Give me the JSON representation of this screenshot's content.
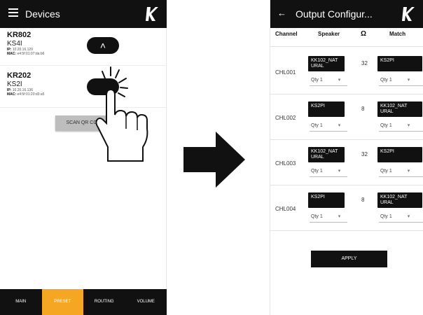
{
  "left_screen": {
    "title": "Devices",
    "devices": [
      {
        "name": "KR802",
        "model": "KS4I",
        "ip_label": "IP:",
        "ip": "10.20.16.120",
        "mac_label": "MAC:",
        "mac": "e4:5f:01:07:da:b6"
      },
      {
        "name": "KR202",
        "model": "KS2I",
        "ip_label": "IP:",
        "ip": "10.20.16.136",
        "mac_label": "MAC:",
        "mac": "e4:5f:01:20:d3:a5"
      }
    ],
    "collapse_glyph": "˄",
    "scan_button": "SCAN QR CODE",
    "bottom_nav": [
      "MAIN",
      "PRESET",
      "ROUTING",
      "VOLUME"
    ],
    "active_tab": "PRESET",
    "accent_color": "#f5a623"
  },
  "right_screen": {
    "title": "Output Configur...",
    "headers": {
      "channel": "Channel",
      "speaker": "Speaker",
      "ohm": "Ω",
      "match": "Match"
    },
    "rows": [
      {
        "channel": "CHL001",
        "speaker": "KK102_NAT URAL",
        "ohm": "32",
        "match": "KS2PI",
        "qty_speaker": "Qty 1",
        "qty_match": "Qty 1"
      },
      {
        "channel": "CHL002",
        "speaker": "KS2PI",
        "ohm": "8",
        "match": "KK102_NAT URAL",
        "qty_speaker": "Qty 1",
        "qty_match": "Qty 1"
      },
      {
        "channel": "CHL003",
        "speaker": "KK102_NAT URAL",
        "ohm": "32",
        "match": "KS2PI",
        "qty_speaker": "Qty 1",
        "qty_match": "Qty 1"
      },
      {
        "channel": "CHL004",
        "speaker": "KS2PI",
        "ohm": "8",
        "match": "KK102_NAT URAL",
        "qty_speaker": "Qty 1",
        "qty_match": "Qty 1"
      }
    ],
    "qty_caret": "▾",
    "apply_button": "APPLY"
  }
}
